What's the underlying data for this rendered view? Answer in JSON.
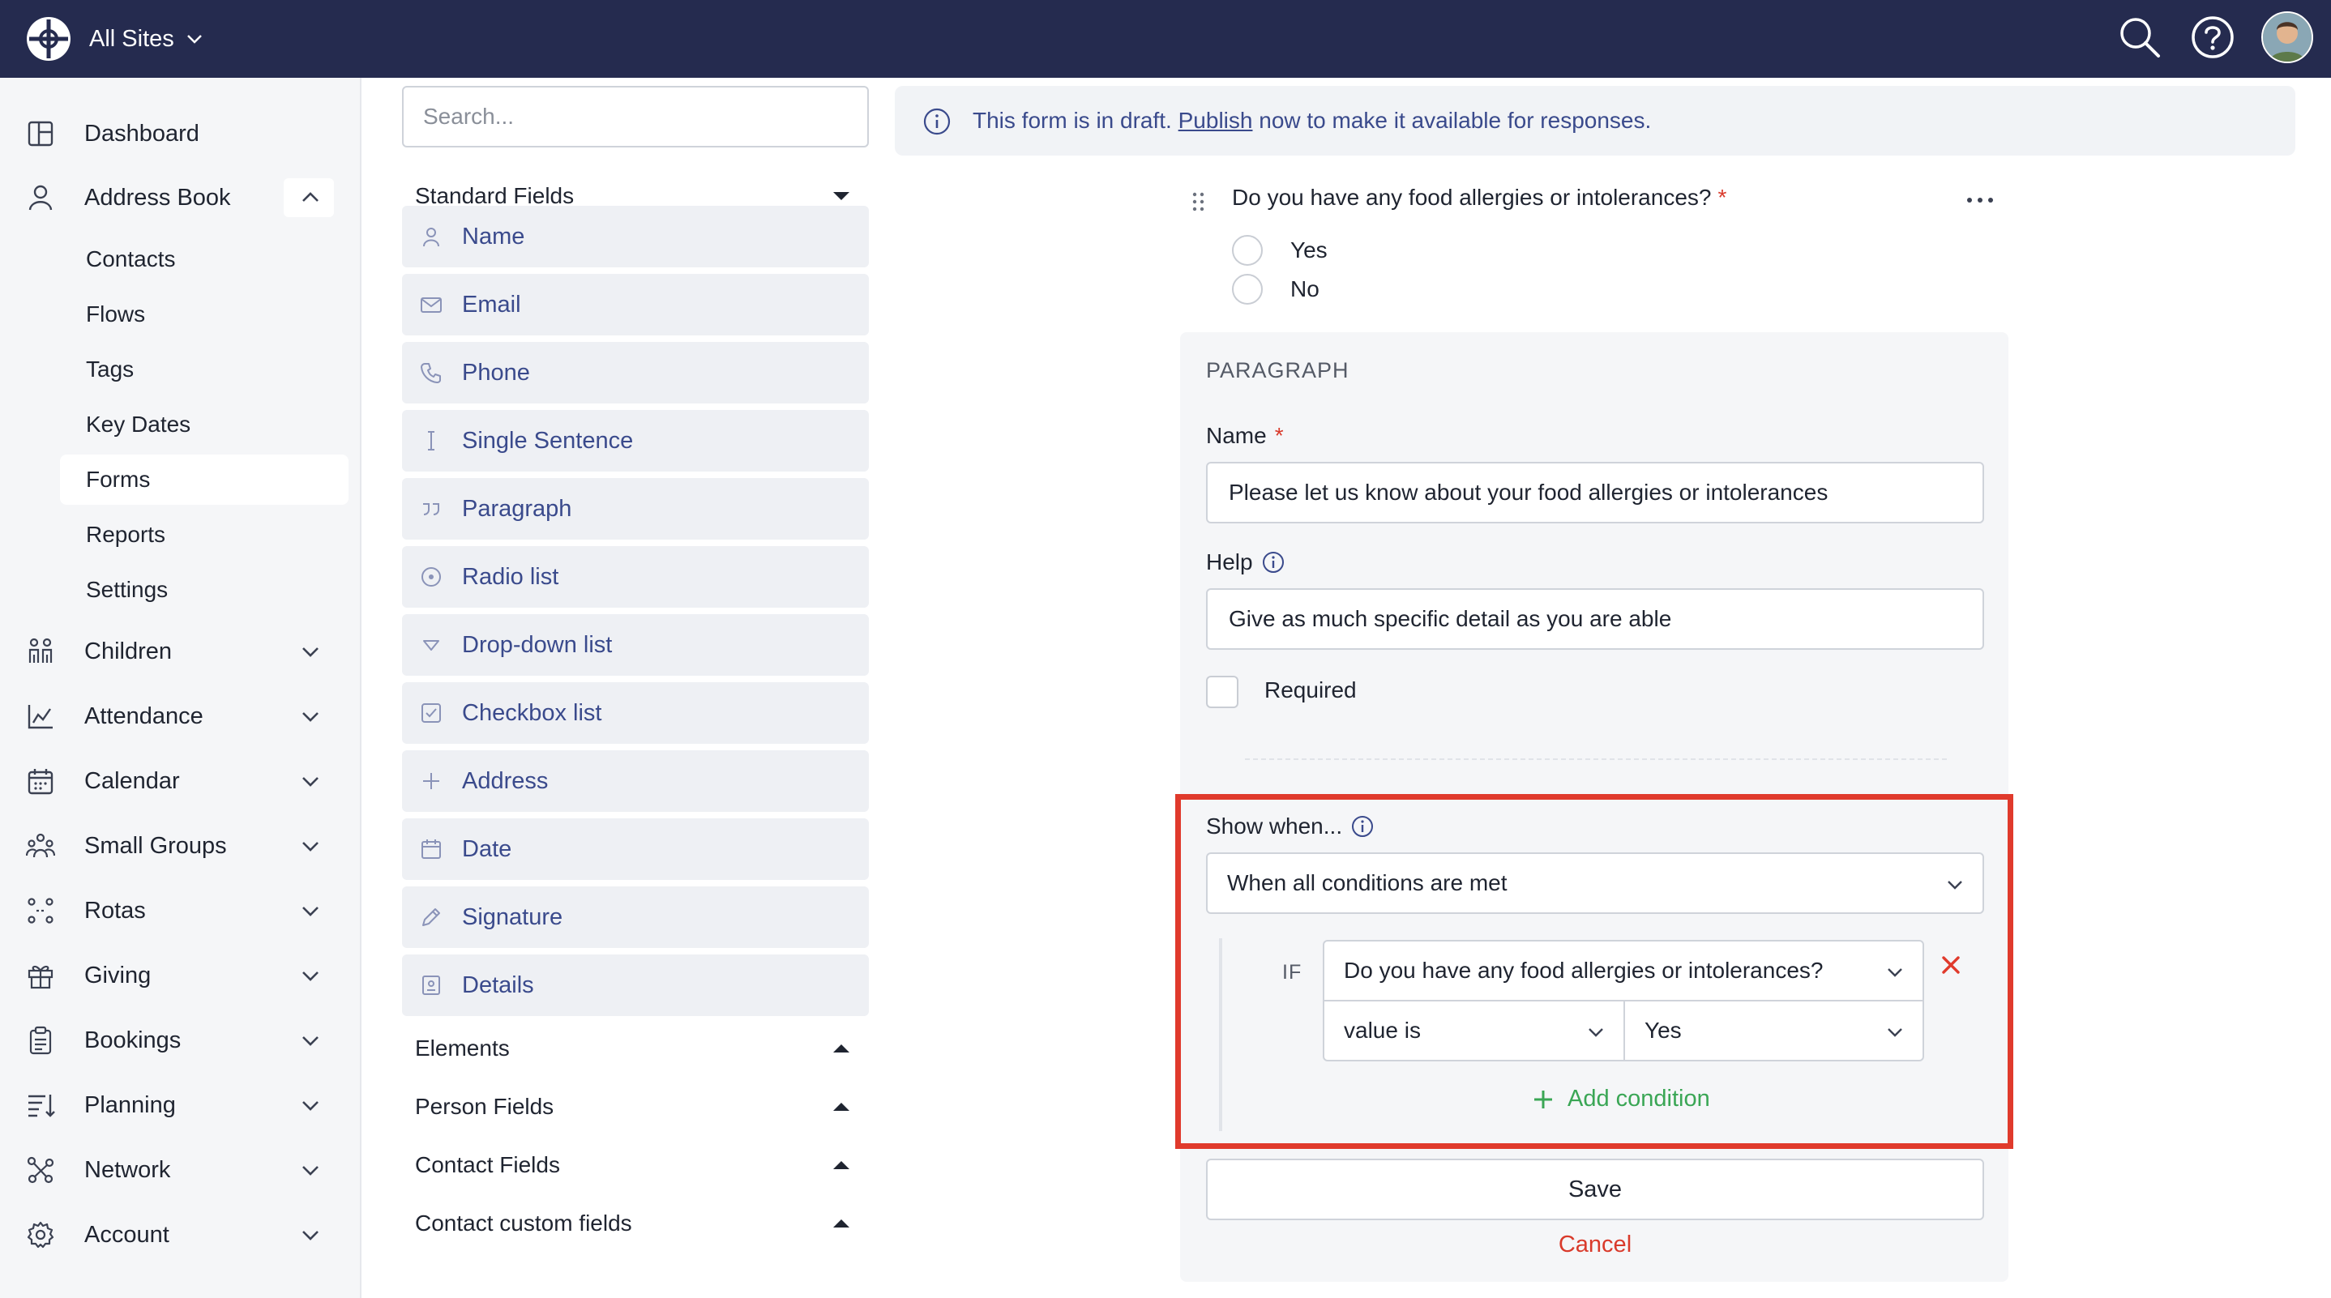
{
  "topbar": {
    "site_switch_label": "All Sites",
    "icons": [
      "logo-icon",
      "chevron-down-icon",
      "search-icon",
      "help-icon",
      "avatar"
    ]
  },
  "sidebar": {
    "items": [
      {
        "label": "Dashboard",
        "icon": "dashboard-icon"
      },
      {
        "label": "Address Book",
        "icon": "person-icon",
        "expanded": true
      },
      {
        "label": "Children",
        "icon": "children-icon"
      },
      {
        "label": "Attendance",
        "icon": "attendance-chart-icon"
      },
      {
        "label": "Calendar",
        "icon": "calendar-icon"
      },
      {
        "label": "Small Groups",
        "icon": "small-groups-icon"
      },
      {
        "label": "Rotas",
        "icon": "rotas-icon"
      },
      {
        "label": "Giving",
        "icon": "gift-icon"
      },
      {
        "label": "Bookings",
        "icon": "clipboard-icon"
      },
      {
        "label": "Planning",
        "icon": "planning-icon"
      },
      {
        "label": "Network",
        "icon": "network-icon"
      },
      {
        "label": "Account",
        "icon": "gear-icon"
      }
    ],
    "address_book_sub": [
      "Contacts",
      "Flows",
      "Tags",
      "Key Dates",
      "Forms",
      "Reports",
      "Settings"
    ],
    "active_sub": "Forms"
  },
  "palette": {
    "search_placeholder": "Search...",
    "standard_fields_label": "Standard Fields",
    "fields": [
      {
        "label": "Name",
        "icon": "person-icon"
      },
      {
        "label": "Email",
        "icon": "envelope-icon"
      },
      {
        "label": "Phone",
        "icon": "phone-icon"
      },
      {
        "label": "Single Sentence",
        "icon": "text-cursor-icon"
      },
      {
        "label": "Paragraph",
        "icon": "quote-icon"
      },
      {
        "label": "Radio list",
        "icon": "radio-icon"
      },
      {
        "label": "Drop-down list",
        "icon": "dropdown-triangle-icon"
      },
      {
        "label": "Checkbox list",
        "icon": "checkbox-icon"
      },
      {
        "label": "Address",
        "icon": "plus-icon"
      },
      {
        "label": "Date",
        "icon": "calendar-icon"
      },
      {
        "label": "Signature",
        "icon": "pen-icon"
      },
      {
        "label": "Details",
        "icon": "id-card-icon"
      }
    ],
    "groups": [
      "Elements",
      "Person Fields",
      "Contact Fields",
      "Contact custom fields"
    ]
  },
  "banner": {
    "text_before": "This form is in draft. ",
    "link": "Publish",
    "text_after": " now to make it available for responses."
  },
  "question": {
    "title": "Do you have any food allergies or intolerances?",
    "required_mark": "*",
    "options": [
      "Yes",
      "No"
    ]
  },
  "editor": {
    "section_title": "PARAGRAPH",
    "name_label": "Name",
    "name_required_mark": "*",
    "name_value": "Please let us know about your food allergies or intolerances",
    "help_label": "Help",
    "help_value": "Give as much specific detail as you are able",
    "required_label": "Required",
    "show_when_label": "Show when...",
    "condition_mode": "When all conditions are met",
    "if_label": "IF",
    "condition_question": "Do you have any food allergies or intolerances?",
    "condition_operator": "value is",
    "condition_value": "Yes",
    "add_condition_label": "Add condition",
    "save_label": "Save",
    "cancel_label": "Cancel"
  },
  "colors": {
    "topbar": "#252b4f",
    "accent_link": "#3a4a8c",
    "danger": "#d93a2b",
    "success": "#3aa655",
    "highlight": "#e03a2c"
  }
}
